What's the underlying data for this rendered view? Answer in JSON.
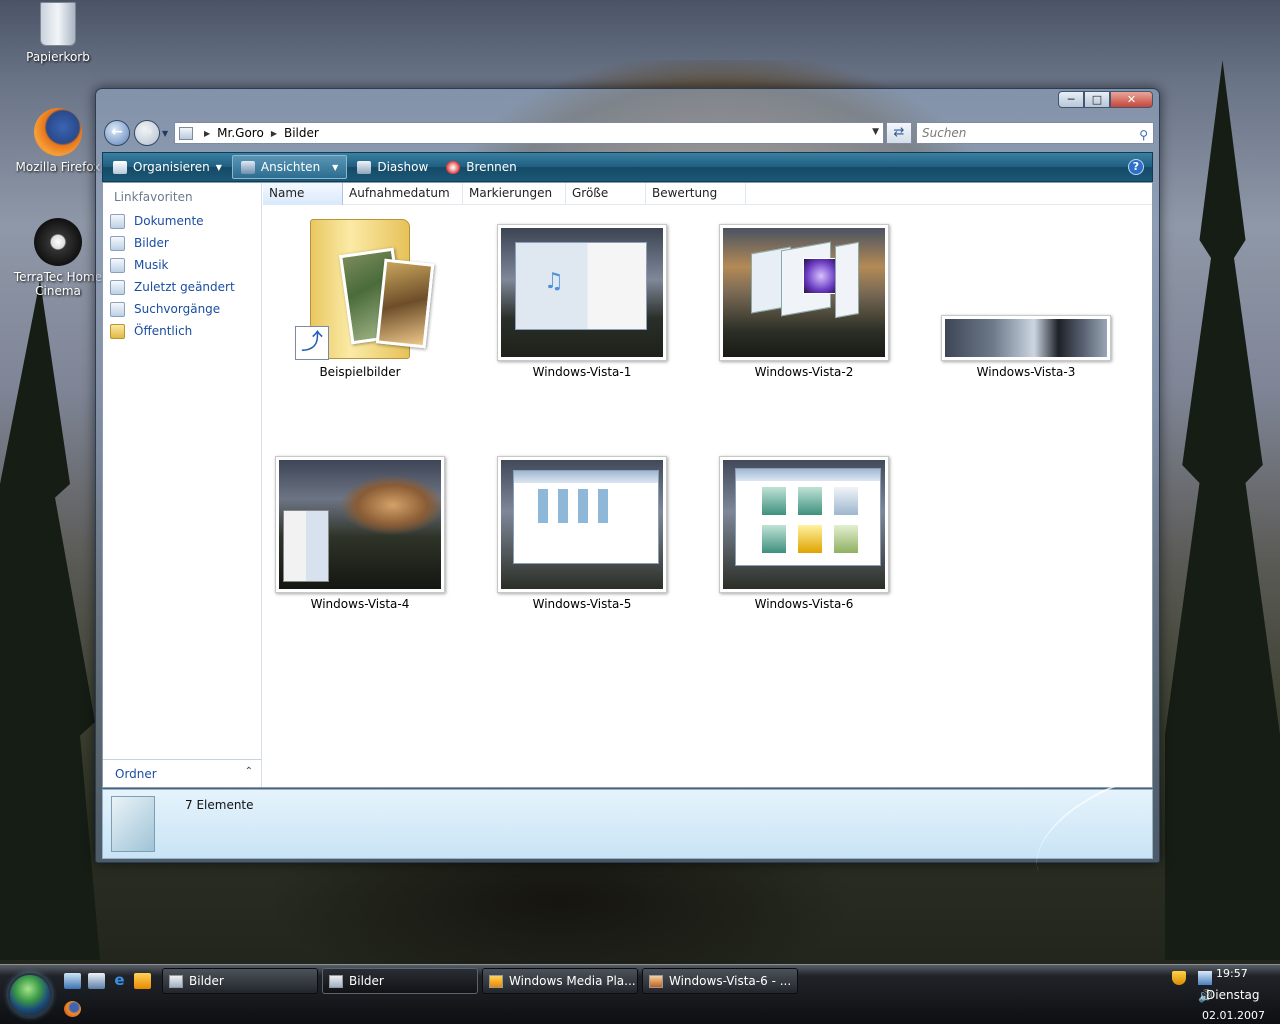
{
  "desktop": {
    "icons": [
      {
        "name": "recycle-bin",
        "label": "Papierkorb"
      },
      {
        "name": "firefox",
        "label": "Mozilla Firefox"
      },
      {
        "name": "terratec",
        "label": "TerraTec Home Cinema"
      }
    ]
  },
  "window": {
    "caption_buttons": {
      "minimize": "─",
      "maximize": "□",
      "close": "✕"
    },
    "address": {
      "crumbs": [
        "Mr.Goro",
        "Bilder"
      ]
    },
    "search": {
      "placeholder": "Suchen"
    },
    "toolbar": {
      "organize": "Organisieren",
      "views": "Ansichten",
      "slideshow": "Diashow",
      "burn": "Brennen",
      "help": "?"
    },
    "nav_pane": {
      "title": "Linkfavoriten",
      "links": [
        "Dokumente",
        "Bilder",
        "Musik",
        "Zuletzt geändert",
        "Suchvorgänge",
        "Öffentlich"
      ],
      "folders_label": "Ordner"
    },
    "columns": [
      "Name",
      "Aufnahmedatum",
      "Markierungen",
      "Größe",
      "Bewertung"
    ],
    "items": [
      {
        "label": "Beispielbilder",
        "kind": "folder"
      },
      {
        "label": "Windows-Vista-1",
        "kind": "image"
      },
      {
        "label": "Windows-Vista-2",
        "kind": "image"
      },
      {
        "label": "Windows-Vista-3",
        "kind": "image"
      },
      {
        "label": "Windows-Vista-4",
        "kind": "image"
      },
      {
        "label": "Windows-Vista-5",
        "kind": "image"
      },
      {
        "label": "Windows-Vista-6",
        "kind": "image"
      }
    ],
    "status": {
      "count": "7 Elemente"
    }
  },
  "taskbar": {
    "buttons": [
      "Bilder",
      "Bilder",
      "Windows Media Pla...",
      "Windows-Vista-6 - ..."
    ],
    "active_index": 1,
    "clock": {
      "time": "19:57",
      "day": "Dienstag",
      "date": "02.01.2007"
    }
  },
  "colors": {
    "toolbar": "#1e5e80",
    "link": "#1a4ea2",
    "taskbar": "#0d0f12"
  }
}
